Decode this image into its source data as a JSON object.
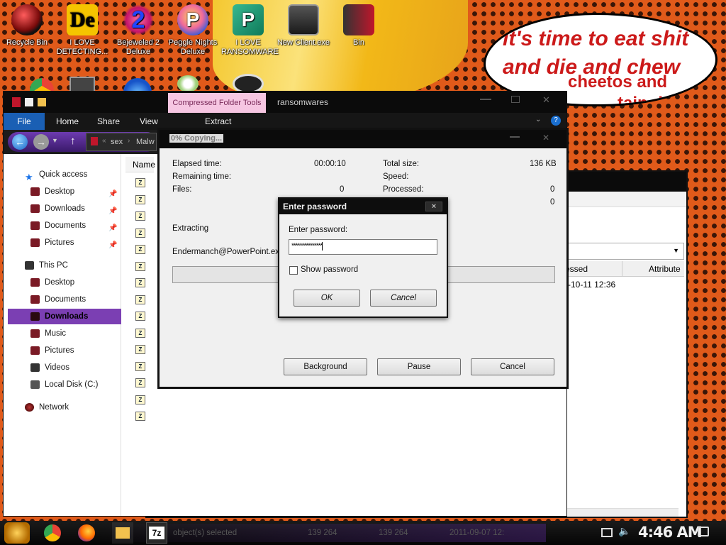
{
  "desktop": {
    "icons": [
      {
        "label": "Recycle Bin",
        "icon": "recycle-bin-icon"
      },
      {
        "label": "I LOVE DETECTING...",
        "icon": "de-icon"
      },
      {
        "label": "Bejeweled 2 Deluxe",
        "icon": "bejeweled-icon"
      },
      {
        "label": "Peggle Nights Deluxe",
        "icon": "peggle-icon"
      },
      {
        "label": "I LOVE RANSOMWARE",
        "icon": "publisher-icon"
      },
      {
        "label": "New Client.exe",
        "icon": "exe-icon"
      },
      {
        "label": "Bin",
        "icon": "bin-icon"
      }
    ],
    "bubble_text": "it's time to eat shit and die and chew",
    "bubble_overlay": "cheetos and",
    "bubble_overlay2": "tain dew"
  },
  "explorer": {
    "compressed_tools": "Compressed Folder Tools",
    "title": "ransomwares",
    "tabs": [
      "File",
      "Home",
      "Share",
      "View"
    ],
    "extract_tab": "Extract",
    "breadcrumb": [
      "sex",
      "Malw"
    ],
    "column_name": "Name",
    "sidebar": {
      "quick_access": "Quick access",
      "qa_items": [
        "Desktop",
        "Downloads",
        "Documents",
        "Pictures"
      ],
      "this_pc": "This PC",
      "pc_items": [
        "Desktop",
        "Documents",
        "Downloads",
        "Music",
        "Pictures",
        "Videos",
        "Local Disk (C:)"
      ],
      "network": "Network"
    },
    "status": {
      "selected": "object(s) selected",
      "size1": "139 264",
      "size2": "139 264",
      "date": "2011-09-07 12:"
    }
  },
  "back_window": {
    "col_pressed": "essed",
    "col_attribute": "Attribute",
    "row_date": "-10-11 12:36"
  },
  "copy_dialog": {
    "title": "0% Copying...",
    "elapsed_label": "Elapsed time:",
    "elapsed_value": "00:00:10",
    "remaining_label": "Remaining time:",
    "files_label": "Files:",
    "files_value": "0",
    "total_label": "Total size:",
    "total_value": "136 KB",
    "speed_label": "Speed:",
    "processed_label": "Processed:",
    "processed_value": "0",
    "extra_value": "0",
    "extracting_label": "Extracting",
    "file_name": "Endermanch@PowerPoint.exe",
    "progress_fraction": 0.0,
    "background_btn": "Background",
    "pause_btn": "Pause",
    "cancel_btn": "Cancel"
  },
  "password_dialog": {
    "title": "Enter password",
    "close": "×",
    "prompt": "Enter password:",
    "value": "***************",
    "show_password": "Show password",
    "ok": "OK",
    "cancel": "Cancel"
  },
  "taskbar": {
    "clock": "4:46 AM",
    "sevenzip": "7z"
  }
}
